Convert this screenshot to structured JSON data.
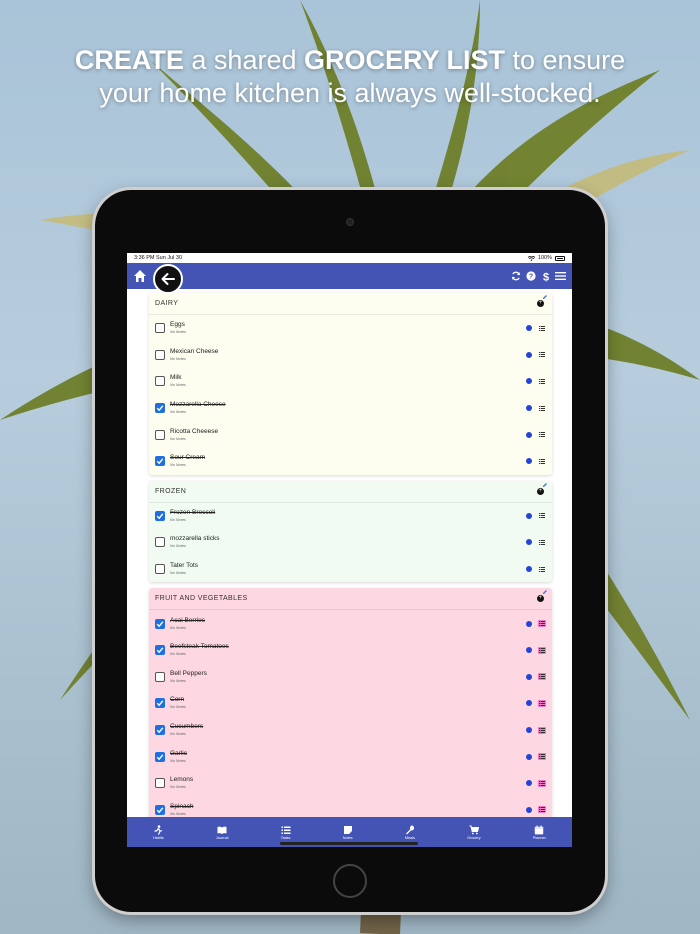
{
  "headline": {
    "line1_bold1": "CREATE",
    "line1_text1": " a shared ",
    "line1_bold2": "GROCERY LIST",
    "line1_text2": " to ensure",
    "line2": "your home kitchen is always well-stocked."
  },
  "status": {
    "time": "3:36 PM  Sun Jul 30",
    "battery": "100%"
  },
  "nav": {
    "icons": [
      "home-icon",
      "back-arrow-icon",
      "sync-icon",
      "help-icon",
      "dollar-icon",
      "hamburger-menu-icon"
    ],
    "accent": "#4354b5"
  },
  "sections": [
    {
      "title": "DAIRY",
      "color": "#fdfdf0",
      "items": [
        {
          "name": "Eggs",
          "note": "No Notes",
          "checked": false
        },
        {
          "name": "Mexican Cheese",
          "note": "No Notes",
          "checked": false
        },
        {
          "name": "Milk",
          "note": "No Notes",
          "checked": false
        },
        {
          "name": "Mozzarella Cheese",
          "note": "No Notes",
          "checked": true
        },
        {
          "name": "Ricotta Cheeese",
          "note": "No Notes",
          "checked": false
        },
        {
          "name": "Sour Cream",
          "note": "No Notes",
          "checked": true
        }
      ]
    },
    {
      "title": "FROZEN",
      "color": "#f2fbf2",
      "items": [
        {
          "name": "Frozen Broccoli",
          "note": "No Notes",
          "checked": true
        },
        {
          "name": "mozzarella sticks",
          "note": "No Notes",
          "checked": false
        },
        {
          "name": "Tater Tots",
          "note": "No Notes",
          "checked": false
        }
      ]
    },
    {
      "title": "FRUIT AND VEGETABLES",
      "color": "#fdd7e1",
      "items": [
        {
          "name": "Acai Berries",
          "note": "No Notes",
          "checked": true
        },
        {
          "name": "Beefsteak Tomatoes",
          "note": "No Notes",
          "checked": true
        },
        {
          "name": "Bell Peppers",
          "note": "No Notes",
          "checked": false
        },
        {
          "name": "Corn",
          "note": "No Notes",
          "checked": true
        },
        {
          "name": "Cucumbers",
          "note": "No Notes",
          "checked": true
        },
        {
          "name": "Garlic",
          "note": "No Notes",
          "checked": true
        },
        {
          "name": "Lemons",
          "note": "No Notes",
          "checked": false
        },
        {
          "name": "Spinach",
          "note": "No Notes",
          "checked": true
        }
      ]
    }
  ],
  "tabs": [
    {
      "label": "Habits",
      "icon": "running-icon"
    },
    {
      "label": "Journal",
      "icon": "book-icon"
    },
    {
      "label": "Tasks",
      "icon": "list-icon"
    },
    {
      "label": "Notes",
      "icon": "note-icon"
    },
    {
      "label": "Meals",
      "icon": "spoon-icon"
    },
    {
      "label": "Grocery",
      "icon": "cart-icon"
    },
    {
      "label": "Planner",
      "icon": "calendar-icon"
    }
  ]
}
